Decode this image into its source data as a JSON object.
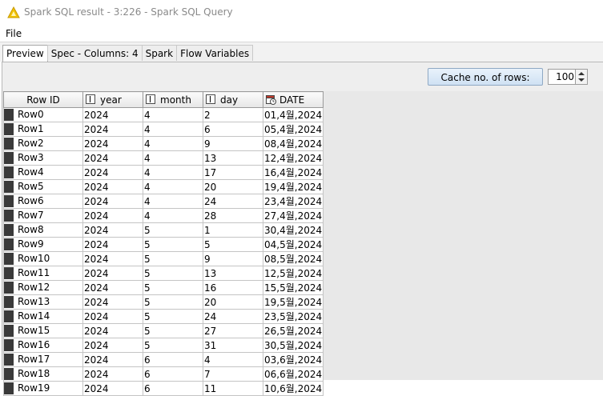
{
  "window": {
    "title": "Spark SQL result - 3:226 - Spark SQL Query"
  },
  "menu": {
    "file": "File"
  },
  "tabs": [
    "Preview",
    "Spec - Columns: 4",
    "Spark",
    "Flow Variables"
  ],
  "toolbar": {
    "cache_label": "Cache no. of rows:",
    "cache_value": "100"
  },
  "table": {
    "columns": [
      "Row ID",
      "year",
      "month",
      "day",
      "DATE"
    ],
    "rows": [
      [
        "Row0",
        "2024",
        "4",
        "2",
        "01,4월,2024"
      ],
      [
        "Row1",
        "2024",
        "4",
        "6",
        "05,4월,2024"
      ],
      [
        "Row2",
        "2024",
        "4",
        "9",
        "08,4월,2024"
      ],
      [
        "Row3",
        "2024",
        "4",
        "13",
        "12,4월,2024"
      ],
      [
        "Row4",
        "2024",
        "4",
        "17",
        "16,4월,2024"
      ],
      [
        "Row5",
        "2024",
        "4",
        "20",
        "19,4월,2024"
      ],
      [
        "Row6",
        "2024",
        "4",
        "24",
        "23,4월,2024"
      ],
      [
        "Row7",
        "2024",
        "4",
        "28",
        "27,4월,2024"
      ],
      [
        "Row8",
        "2024",
        "5",
        "1",
        "30,4월,2024"
      ],
      [
        "Row9",
        "2024",
        "5",
        "5",
        "04,5월,2024"
      ],
      [
        "Row10",
        "2024",
        "5",
        "9",
        "08,5월,2024"
      ],
      [
        "Row11",
        "2024",
        "5",
        "13",
        "12,5월,2024"
      ],
      [
        "Row12",
        "2024",
        "5",
        "16",
        "15,5월,2024"
      ],
      [
        "Row13",
        "2024",
        "5",
        "20",
        "19,5월,2024"
      ],
      [
        "Row14",
        "2024",
        "5",
        "24",
        "23,5월,2024"
      ],
      [
        "Row15",
        "2024",
        "5",
        "27",
        "26,5월,2024"
      ],
      [
        "Row16",
        "2024",
        "5",
        "31",
        "30,5월,2024"
      ],
      [
        "Row17",
        "2024",
        "6",
        "4",
        "03,6월,2024"
      ],
      [
        "Row18",
        "2024",
        "6",
        "7",
        "06,6월,2024"
      ],
      [
        "Row19",
        "2024",
        "6",
        "11",
        "10,6월,2024"
      ]
    ]
  },
  "colors": {
    "accent_icon": "#f2c200",
    "cache_button_bg": "#d8e7f6",
    "row_marker": "#3a3a3a"
  }
}
